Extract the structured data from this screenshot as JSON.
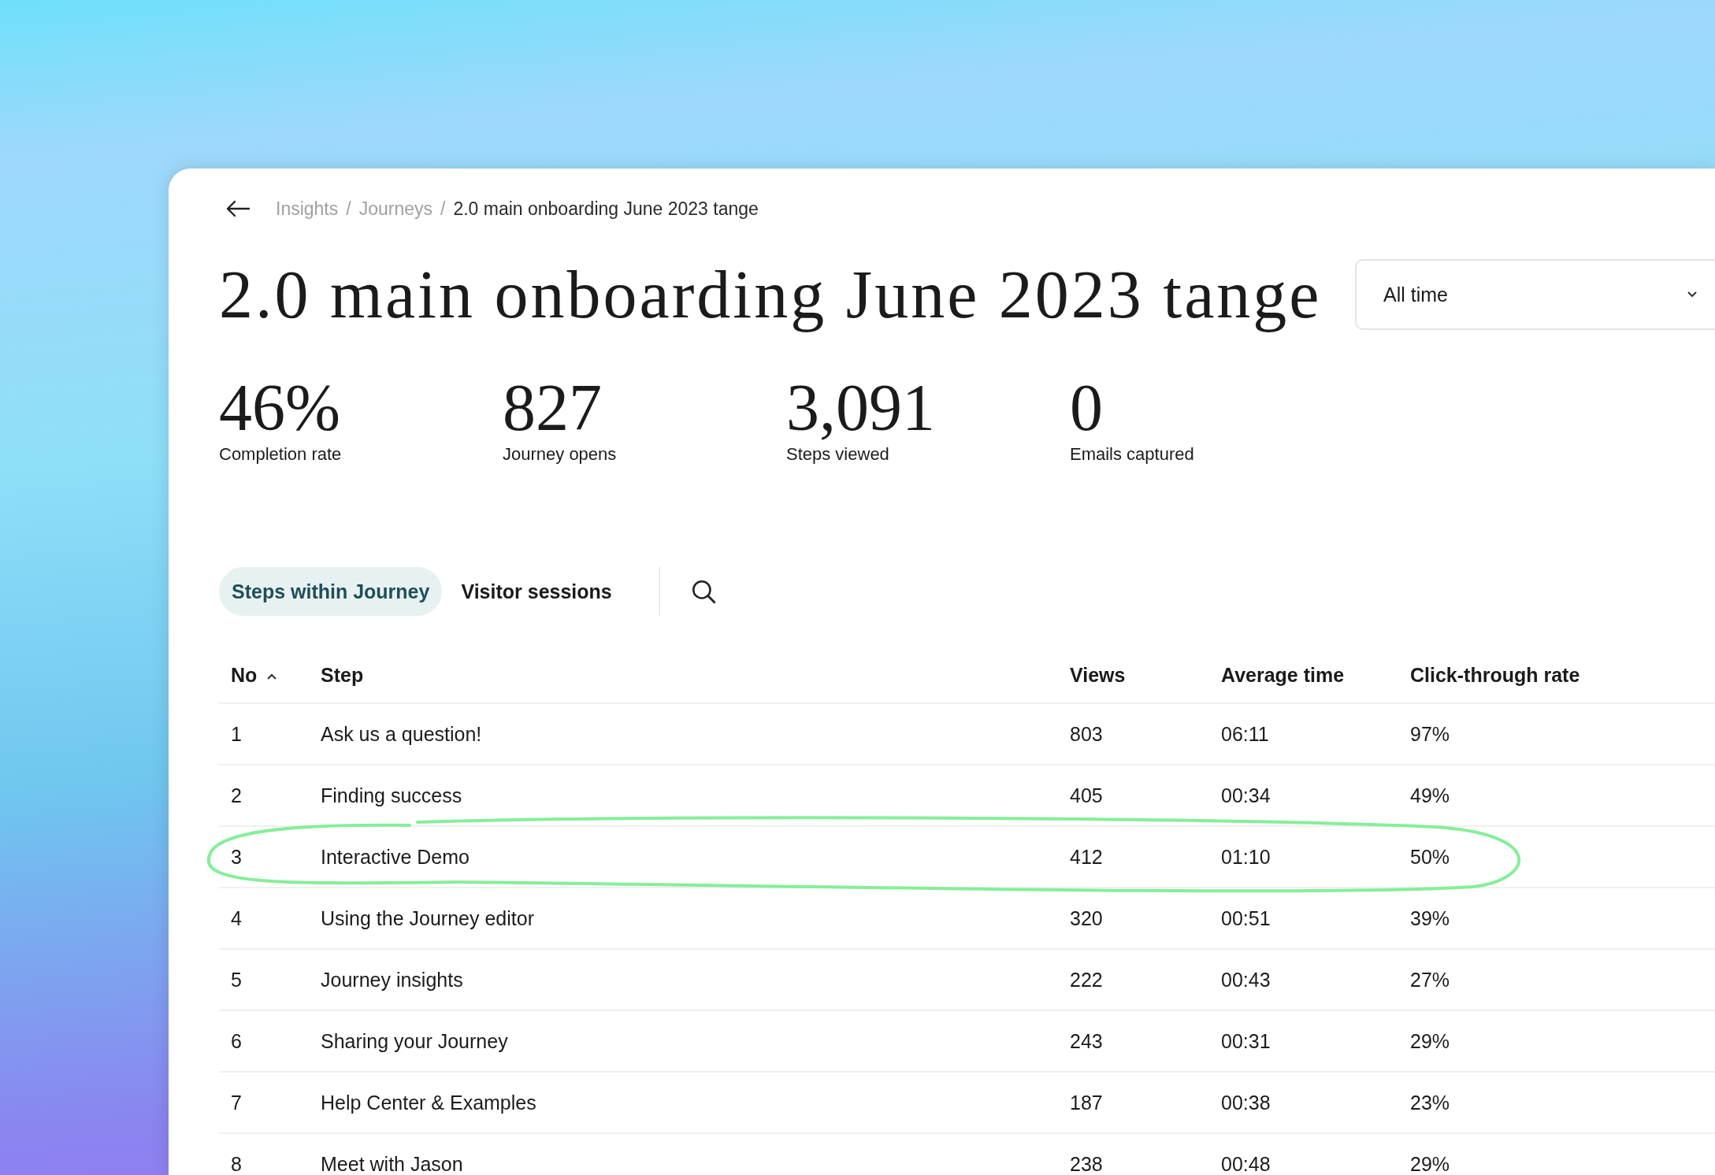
{
  "breadcrumb": {
    "items": [
      "Insights",
      "Journeys",
      "2.0 main onboarding June 2023 tange"
    ],
    "separator": "/"
  },
  "title": "2.0 main onboarding June 2023 tange",
  "date_range": {
    "value": "All time"
  },
  "stats": [
    {
      "value": "46%",
      "label": "Completion rate"
    },
    {
      "value": "827",
      "label": "Journey opens"
    },
    {
      "value": "3,091",
      "label": "Steps viewed"
    },
    {
      "value": "0",
      "label": "Emails captured"
    }
  ],
  "tabs": [
    {
      "label": "Steps within Journey",
      "selected": true
    },
    {
      "label": "Visitor sessions",
      "selected": false
    }
  ],
  "table": {
    "columns": [
      {
        "label": "No",
        "sorted_ascending": true
      },
      {
        "label": "Step"
      },
      {
        "label": "Views"
      },
      {
        "label": "Average time"
      },
      {
        "label": "Click-through rate"
      }
    ],
    "rows": [
      {
        "no": "1",
        "step": "Ask us a question!",
        "views": "803",
        "avg_time": "06:11",
        "ctr": "97%",
        "highlighted": false
      },
      {
        "no": "2",
        "step": "Finding success",
        "views": "405",
        "avg_time": "00:34",
        "ctr": "49%",
        "highlighted": false
      },
      {
        "no": "3",
        "step": "Interactive Demo",
        "views": "412",
        "avg_time": "01:10",
        "ctr": "50%",
        "highlighted": true
      },
      {
        "no": "4",
        "step": "Using the Journey editor",
        "views": "320",
        "avg_time": "00:51",
        "ctr": "39%",
        "highlighted": false
      },
      {
        "no": "5",
        "step": "Journey insights",
        "views": "222",
        "avg_time": "00:43",
        "ctr": "27%",
        "highlighted": false
      },
      {
        "no": "6",
        "step": "Sharing your Journey",
        "views": "243",
        "avg_time": "00:31",
        "ctr": "29%",
        "highlighted": false
      },
      {
        "no": "7",
        "step": "Help Center & Examples",
        "views": "187",
        "avg_time": "00:38",
        "ctr": "23%",
        "highlighted": false
      },
      {
        "no": "8",
        "step": "Meet with Jason",
        "views": "238",
        "avg_time": "00:48",
        "ctr": "29%",
        "highlighted": false
      }
    ]
  }
}
